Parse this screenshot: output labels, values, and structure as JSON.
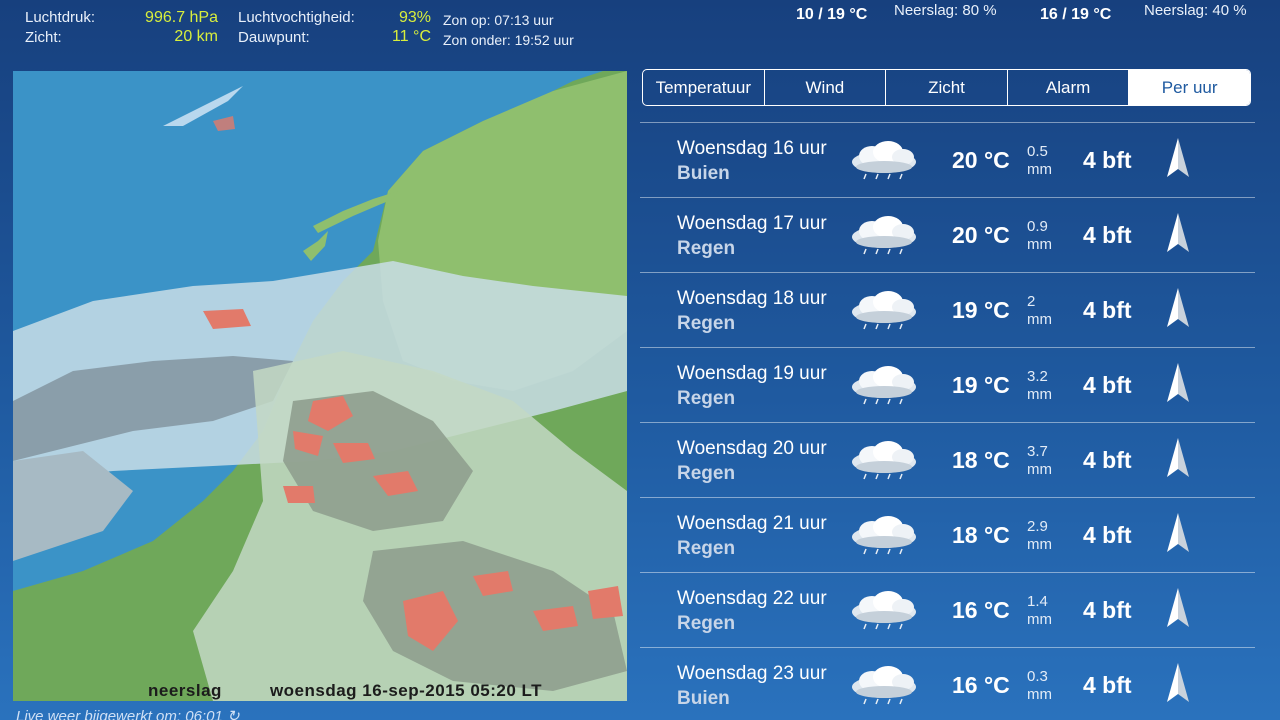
{
  "top": {
    "pressure_label": "Luchtdruk:",
    "pressure_value": "996.7 hPa",
    "visibility_label": "Zicht:",
    "visibility_value": "20 km",
    "humidity_label": "Luchtvochtigheid:",
    "humidity_value": "93%",
    "dewpoint_label": "Dauwpunt:",
    "dewpoint_value": "11 °C",
    "sunrise": "Zon op: 07:13 uur",
    "sunset": "Zon onder: 19:52 uur",
    "forecast1_temp": "10 / 19 °C",
    "forecast1_rain": "Neerslag: 80 %",
    "forecast2_temp": "16 / 19 °C",
    "forecast2_rain": "Neerslag: 40 %"
  },
  "map": {
    "caption_left": "neerslag",
    "caption_right": "woensdag 16-sep-2015 05:20 LT",
    "updated": "Live weer bijgewerkt om: 06:01"
  },
  "tabs": [
    {
      "label": "Temperatuur",
      "active": false
    },
    {
      "label": "Wind",
      "active": false
    },
    {
      "label": "Zicht",
      "active": false
    },
    {
      "label": "Alarm",
      "active": false
    },
    {
      "label": "Per uur",
      "active": true
    }
  ],
  "hourly": [
    {
      "time": "Woensdag 16 uur",
      "condition": "Buien",
      "temp": "20 °C",
      "rain": "0.5",
      "unit": "mm",
      "wind": "4 bft",
      "icon": "cloud-rain-icon"
    },
    {
      "time": "Woensdag 17 uur",
      "condition": "Regen",
      "temp": "20 °C",
      "rain": "0.9",
      "unit": "mm",
      "wind": "4 bft",
      "icon": "cloud-rain-icon"
    },
    {
      "time": "Woensdag 18 uur",
      "condition": "Regen",
      "temp": "19 °C",
      "rain": "2",
      "unit": "mm",
      "wind": "4 bft",
      "icon": "cloud-rain-icon"
    },
    {
      "time": "Woensdag 19 uur",
      "condition": "Regen",
      "temp": "19 °C",
      "rain": "3.2",
      "unit": "mm",
      "wind": "4 bft",
      "icon": "cloud-rain-icon"
    },
    {
      "time": "Woensdag 20 uur",
      "condition": "Regen",
      "temp": "18 °C",
      "rain": "3.7",
      "unit": "mm",
      "wind": "4 bft",
      "icon": "cloud-rain-icon"
    },
    {
      "time": "Woensdag 21 uur",
      "condition": "Regen",
      "temp": "18 °C",
      "rain": "2.9",
      "unit": "mm",
      "wind": "4 bft",
      "icon": "cloud-rain-icon"
    },
    {
      "time": "Woensdag 22 uur",
      "condition": "Regen",
      "temp": "16 °C",
      "rain": "1.4",
      "unit": "mm",
      "wind": "4 bft",
      "icon": "cloud-rain-icon"
    },
    {
      "time": "Woensdag 23 uur",
      "condition": "Buien",
      "temp": "16 °C",
      "rain": "0.3",
      "unit": "mm",
      "wind": "4 bft",
      "icon": "cloud-rain-icon"
    }
  ],
  "colors": {
    "accent_value": "#d8ee3c",
    "background_top": "#17407e",
    "background_bottom": "#2a72bd",
    "sea": "#3b93c7",
    "land": "#6fa85a",
    "rain_heavy": "#e27a6a"
  }
}
